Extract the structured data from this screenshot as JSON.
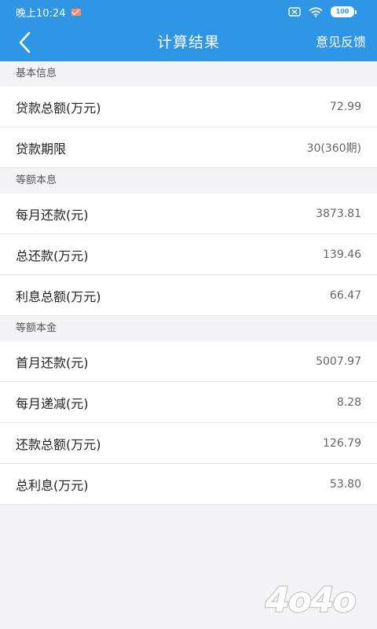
{
  "status_bar": {
    "time": "晚上10:24",
    "battery": "100"
  },
  "nav": {
    "title": "计算结果",
    "feedback": "意见反馈"
  },
  "sections": [
    {
      "header": "基本信息",
      "rows": [
        {
          "label": "贷款总额(万元)",
          "value": "72.99"
        },
        {
          "label": "贷款期限",
          "value": "30(360期)"
        }
      ]
    },
    {
      "header": "等额本息",
      "rows": [
        {
          "label": "每月还款(元)",
          "value": "3873.81"
        },
        {
          "label": "总还款(万元)",
          "value": "139.46"
        },
        {
          "label": "利息总额(万元)",
          "value": "66.47"
        }
      ]
    },
    {
      "header": "等额本金",
      "rows": [
        {
          "label": "首月还款(元)",
          "value": "5007.97"
        },
        {
          "label": "每月递减(元)",
          "value": "8.28"
        },
        {
          "label": "还款总额(万元)",
          "value": "126.79"
        },
        {
          "label": "总利息(万元)",
          "value": "53.80"
        }
      ]
    }
  ],
  "watermark": "4o4o",
  "colors": {
    "header_bar": "#2f96e6",
    "page_bg": "#f4f4f6",
    "row_bg": "#ffffff"
  }
}
